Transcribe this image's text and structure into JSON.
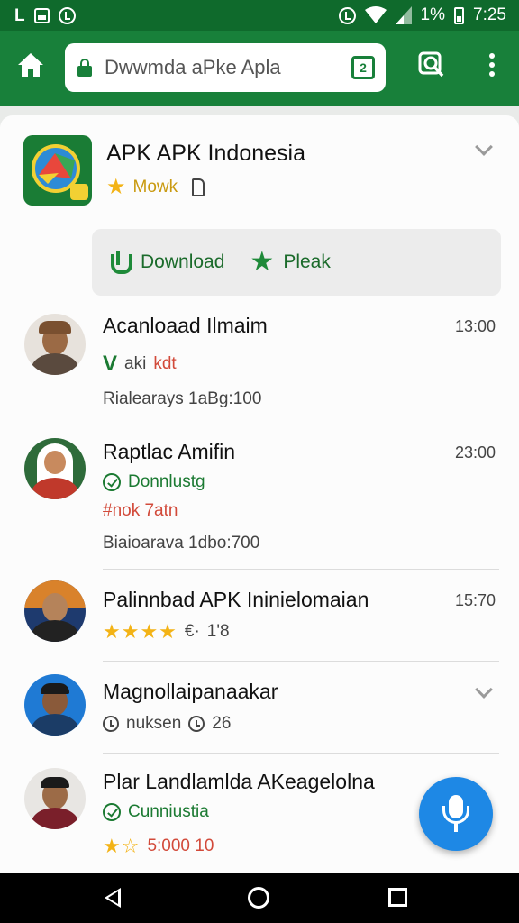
{
  "status_bar": {
    "left_icons": [
      "L",
      "message-icon",
      "sync-icon"
    ],
    "battery": "1%",
    "time": "7:25"
  },
  "browser": {
    "url": "Dwwmda aPke Apla",
    "tab_count": "2"
  },
  "app": {
    "title": "APK APK Indonesia",
    "rating_label": "Mowk"
  },
  "actions": {
    "download": "Download",
    "pleak": "Pleak"
  },
  "items": [
    {
      "title": "Acanloaad Ilmaim",
      "time": "13:00",
      "line1": "aki",
      "line1_red": "kdt",
      "line2": "Rialearays 1aBg:100"
    },
    {
      "title": "Raptlac Amifin",
      "time": "23:00",
      "line1": "Donnlustg",
      "line2": "#nok 7atn",
      "line3": "Biaioarava 1dbo:700"
    },
    {
      "title": "Palinnbad APK Ininielomaian",
      "time": "15:70",
      "rating_extra": "1'8",
      "rating_prefix": "€·"
    },
    {
      "title": "Magnollaipanaakar",
      "line1": "nuksen",
      "line1_extra": "26"
    },
    {
      "title": "Plar Landlamlda AKeagelolna",
      "line1": "Cunniustia",
      "line2": "5:000 10",
      "line2_red": "5:000"
    }
  ],
  "colors": {
    "accent": "#18803a",
    "statusbar": "#0f6a2c",
    "star": "#f3b316",
    "fab": "#1e88e5"
  }
}
